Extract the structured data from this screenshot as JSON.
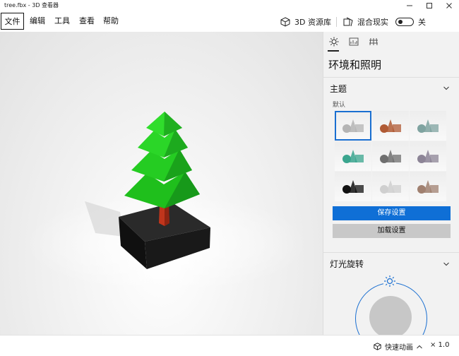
{
  "window": {
    "title": "tree.fbx - 3D 查看器"
  },
  "menu": {
    "file": "文件",
    "edit": "编辑",
    "tools": "工具",
    "view": "查看",
    "help": "帮助"
  },
  "toolbar": {
    "library_label": "3D 资源库",
    "mixed_reality_label": "混合现实",
    "toggle_state": "关"
  },
  "panel": {
    "title": "环境和照明",
    "theme_section": "主题",
    "default_label": "默认",
    "save_button": "保存设置",
    "load_button": "加载设置",
    "light_section": "灯光旋转"
  },
  "statusbar": {
    "animation_label": "快速动画",
    "speed": "× 1.0"
  },
  "colors": {
    "accent": "#0f6fd6",
    "tree_green": "#22c11f",
    "trunk": "#c0351c",
    "base": "#1d1d1d"
  },
  "themes": [
    {
      "name": "default",
      "color": "#b4b4b4"
    },
    {
      "name": "dark-orange",
      "color": "#b05a34"
    },
    {
      "name": "teal-gray",
      "color": "#7fa3a0"
    },
    {
      "name": "teal",
      "color": "#3aa58e"
    },
    {
      "name": "gray",
      "color": "#6f6f6f"
    },
    {
      "name": "purple-gray",
      "color": "#8c8496"
    },
    {
      "name": "black",
      "color": "#111111"
    },
    {
      "name": "light-gray",
      "color": "#cfcfcf"
    },
    {
      "name": "bronze",
      "color": "#a08070"
    }
  ]
}
